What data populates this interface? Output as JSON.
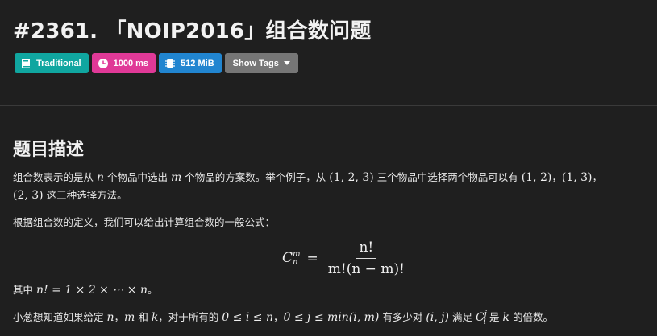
{
  "problem": {
    "title": "#2361. 「NOIP2016」组合数问题"
  },
  "badges": {
    "type": "Traditional",
    "time": "1000 ms",
    "memory": "512 MiB",
    "show_tags": "Show Tags"
  },
  "section": {
    "heading": "题目描述"
  },
  "paragraph1": {
    "t1": "组合数表示的是从",
    "n": "n",
    "t2": "个物品中选出",
    "m": "m",
    "t3": "个物品的方案数。举个例子，从",
    "set": "(1, 2, 3)",
    "t4": "三个物品中选择两个物品可以有",
    "p1": "(1, 2)",
    "sep1": "，",
    "p2": "(1, 3)",
    "sep2": "，",
    "p3": "(2, 3)",
    "t5": "这三种选择方法。"
  },
  "paragraph2": {
    "text": "根据组合数的定义，我们可以给出计算组合数的一般公式："
  },
  "formula": {
    "lhs_base": "C",
    "lhs_sup": "m",
    "lhs_sub": "n",
    "eq": "=",
    "numerator": "n!",
    "denominator": "m!(n − m)!"
  },
  "paragraph3": {
    "t1": "其中",
    "expr": "n! = 1 × 2 × ⋯ × n",
    "t2": "。"
  },
  "paragraph4": {
    "t1": "小葱想知道如果给定",
    "n": "n",
    "sep1": "，",
    "m": "m",
    "t2": "和",
    "k": "k",
    "t3": "，对于所有的",
    "cond1": "0 ≤ i ≤ n",
    "sep2": "，",
    "cond2": "0 ≤ j ≤ min(i, m)",
    "t4": "有多少对",
    "pair": "(i, j)",
    "t5": "满足",
    "c_base": "C",
    "c_sup": "j",
    "c_sub": "i",
    "t6": "是",
    "k2": "k",
    "t7": "的倍数。"
  },
  "colors": {
    "background": "#1f1f1f",
    "badge_type": "#10a6a0",
    "badge_time": "#e03997",
    "badge_memory": "#2185d0",
    "badge_tags": "#767676"
  },
  "icons": {
    "type": "book-icon",
    "time": "clock-icon",
    "memory": "memory-chip-icon",
    "tags": "caret-down-icon"
  }
}
